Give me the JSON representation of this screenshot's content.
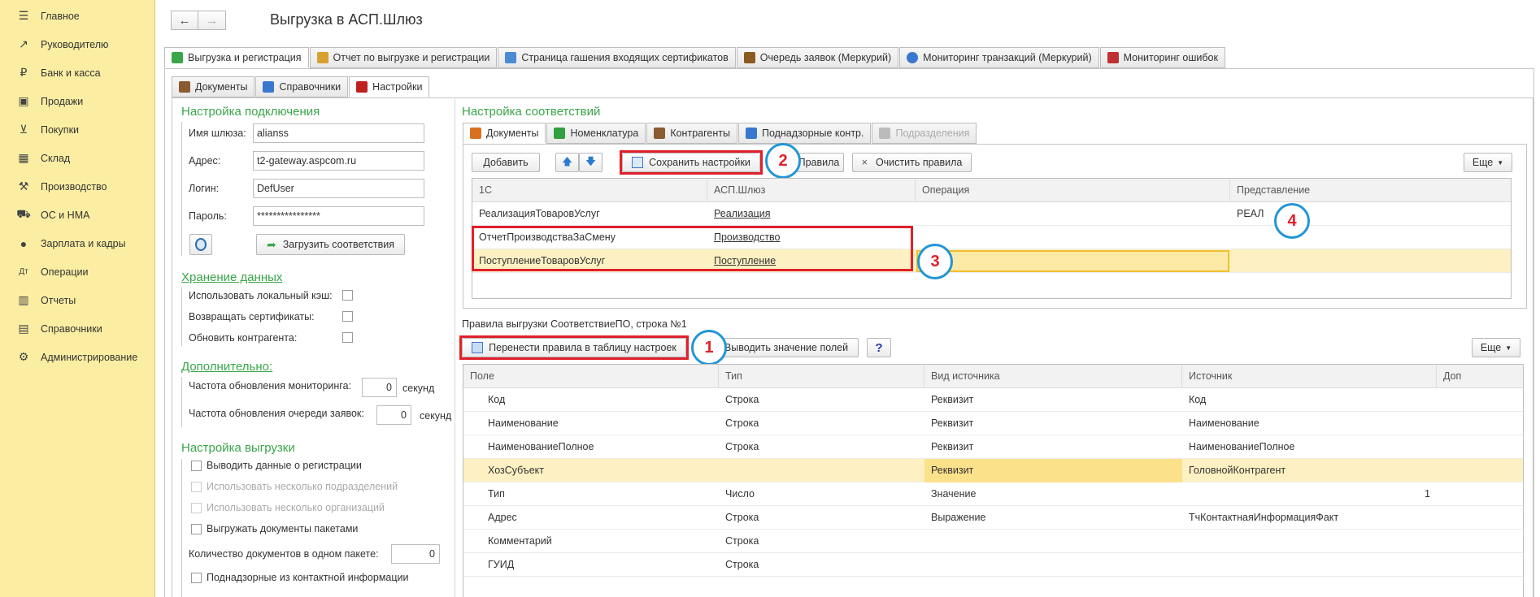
{
  "sidebar": {
    "items": [
      {
        "label": "Главное",
        "icon": "menu-icon"
      },
      {
        "label": "Руководителю",
        "icon": "trend-icon"
      },
      {
        "label": "Банк и касса",
        "icon": "coin-icon"
      },
      {
        "label": "Продажи",
        "icon": "bag-icon"
      },
      {
        "label": "Покупки",
        "icon": "cart-icon"
      },
      {
        "label": "Склад",
        "icon": "warehouse-icon"
      },
      {
        "label": "Производство",
        "icon": "factory-icon"
      },
      {
        "label": "ОС и НМА",
        "icon": "truck-icon"
      },
      {
        "label": "Зарплата и кадры",
        "icon": "person-icon"
      },
      {
        "label": "Операции",
        "icon": "operations-icon"
      },
      {
        "label": "Отчеты",
        "icon": "chart-icon"
      },
      {
        "label": "Справочники",
        "icon": "book-icon"
      },
      {
        "label": "Администрирование",
        "icon": "gear-icon"
      }
    ]
  },
  "header": {
    "title": "Выгрузка в АСП.Шлюз",
    "back": "←",
    "forward": "→"
  },
  "top_tabs": [
    {
      "label": "Выгрузка и регистрация",
      "icon": "upload-icon",
      "color": "#3aa64a"
    },
    {
      "label": "Отчет по выгрузке и регистрации",
      "icon": "report-icon",
      "color": "#d8a030"
    },
    {
      "label": "Страница гашения входящих сертификатов",
      "icon": "certificate-icon",
      "color": "#4a8ad4"
    },
    {
      "label": "Очередь заявок (Меркурий)",
      "icon": "queue-icon",
      "color": "#8a5a20"
    },
    {
      "label": "Мониторинг транзакций (Меркурий)",
      "icon": "pie-icon",
      "color": "#3a78d0"
    },
    {
      "label": "Мониторинг ошибок",
      "icon": "monitor-icon",
      "color": "#c03030"
    }
  ],
  "sub_tabs": [
    {
      "label": "Документы",
      "icon": "briefcase-icon",
      "color": "#8a5a30"
    },
    {
      "label": "Справочники",
      "icon": "directory-icon",
      "color": "#3a78d0"
    },
    {
      "label": "Настройки",
      "icon": "settings-icon",
      "color": "#c02020"
    }
  ],
  "connection": {
    "title": "Настройка подключения",
    "gateway_label": "Имя шлюза:",
    "gateway_value": "alianss",
    "address_label": "Адрес:",
    "address_value": "t2-gateway.aspcom.ru",
    "login_label": "Логин:",
    "login_value": "DefUser",
    "password_label": "Пароль:",
    "password_value": "****************",
    "load_button": "Загрузить соответствия"
  },
  "storage": {
    "title": "Хранение данных",
    "local_cache": "Использовать локальный кэш:",
    "return_certs": "Возвращать сертификаты:",
    "update_contractor": "Обновить контрагента:"
  },
  "extra": {
    "title": "Дополнительно:",
    "monitoring_label": "Частота обновления мониторинга:",
    "monitoring_value": "0",
    "monitoring_unit": "секунд",
    "queue_label": "Частота обновления очереди заявок:",
    "queue_value": "0",
    "queue_unit": "секунд"
  },
  "export_settings": {
    "title": "Настройка выгрузки",
    "show_registration": "Выводить данные о регистрации",
    "multi_subdivisions": "Использовать несколько подразделений",
    "multi_orgs": "Использовать несколько организаций",
    "batch_export": "Выгружать документы пакетами",
    "batch_count_label": "Количество документов в одном пакете:",
    "batch_count_value": "0",
    "supervised_contact": "Поднадзорные из контактной информации"
  },
  "mapping": {
    "title": "Настройка соответствий",
    "tabs": [
      {
        "label": "Документы",
        "icon": "docs-icon",
        "color": "#d87020"
      },
      {
        "label": "Номенклатура",
        "icon": "nomenclature-icon",
        "color": "#30a040"
      },
      {
        "label": "Контрагенты",
        "icon": "contractors-icon",
        "color": "#8a5a30"
      },
      {
        "label": "Поднадзорные контр.",
        "icon": "supervised-icon",
        "color": "#3a78d0"
      },
      {
        "label": "Подразделения",
        "icon": "subdivision-icon",
        "color": "#bbbbbb"
      }
    ],
    "add_button": "Добавить",
    "save_button": "Сохранить настройки",
    "rules_button": "Правила",
    "clear_button": "Очистить правила",
    "more_button": "Еще",
    "columns": [
      "1С",
      "АСП.Шлюз",
      "Операция",
      "Представление"
    ],
    "rows": [
      {
        "c1": "РеализацияТоваровУслуг",
        "c2": "Реализация",
        "c3": "",
        "c4": "РЕАЛ"
      },
      {
        "c1": "ОтчетПроизводстваЗаСмену",
        "c2": "Производство",
        "c3": "",
        "c4": ""
      },
      {
        "c1": "ПоступлениеТоваровУслуг",
        "c2": "Поступление",
        "c3": "",
        "c4": ""
      }
    ]
  },
  "rules": {
    "caption": "Правила выгрузки СоответствиеПО, строка №1",
    "transfer_button": "Перенести правила в таблицу настроек",
    "show_fields_button": "Выводить значение полей",
    "help_button": "?",
    "more_button": "Еще",
    "columns": [
      "Поле",
      "Тип",
      "Вид источника",
      "Источник",
      "Доп"
    ],
    "rows": [
      {
        "field": "Код",
        "type": "Строка",
        "kind": "Реквизит",
        "source": "Код",
        "extra": ""
      },
      {
        "field": "Наименование",
        "type": "Строка",
        "kind": "Реквизит",
        "source": "Наименование",
        "extra": ""
      },
      {
        "field": "НаименованиеПолное",
        "type": "Строка",
        "kind": "Реквизит",
        "source": "НаименованиеПолное",
        "extra": ""
      },
      {
        "field": "ХозСубъект",
        "type": "",
        "kind": "Реквизит",
        "source": "ГоловнойКонтрагент",
        "extra": ""
      },
      {
        "field": "Тип",
        "type": "Число",
        "kind": "Значение",
        "source": "",
        "extra": "1"
      },
      {
        "field": "Адрес",
        "type": "Строка",
        "kind": "Выражение",
        "source": "ТчКонтактнаяИнформацияФакт",
        "extra": ""
      },
      {
        "field": "Комментарий",
        "type": "Строка",
        "kind": "",
        "source": "",
        "extra": ""
      },
      {
        "field": "ГУИД",
        "type": "Строка",
        "kind": "",
        "source": "",
        "extra": ""
      }
    ]
  },
  "markers": {
    "m1": "1",
    "m2": "2",
    "m3": "3",
    "m4": "4"
  },
  "colors": {
    "sidebar": "#fbeea2",
    "accent_green": "#3aa64a",
    "highlight_red": "#e0202b",
    "marker_blue": "#2196d6",
    "selected_row": "#fdf0c2"
  }
}
